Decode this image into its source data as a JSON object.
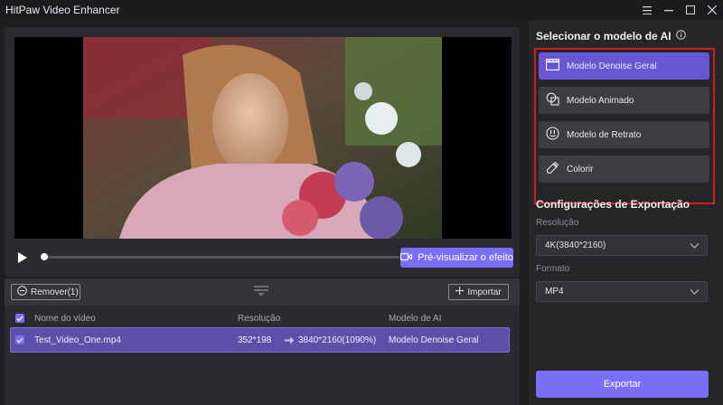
{
  "app": {
    "title": "HitPaw Video Enhancer"
  },
  "player": {
    "preview_label": "Pré-visualizar o efeito",
    "progress": 0
  },
  "list": {
    "remove_label": "Remover(1)",
    "import_label": "Importar",
    "headers": {
      "name": "Nome do vídeo",
      "resolution": "Resolução",
      "model": "Modelo de AI"
    },
    "rows": [
      {
        "name": "Test_Video_One.mp4",
        "res_from": "352*198",
        "res_to": "3840*2160(1090%)",
        "model": "Modelo Denoise Geral"
      }
    ]
  },
  "sidebar": {
    "ai_title": "Selecionar o modelo de AI",
    "models": [
      {
        "label": "Modelo Denoise Geral",
        "icon": "clapperboard-icon",
        "active": true
      },
      {
        "label": "Modelo Animado",
        "icon": "animation-icon",
        "active": false
      },
      {
        "label": "Modelo de Retrato",
        "icon": "portrait-icon",
        "active": false
      },
      {
        "label": "Colorir",
        "icon": "colorize-icon",
        "active": false
      }
    ],
    "export_title": "Configurações de Exportação",
    "resolution_label": "Resolução",
    "resolution_value": "4K(3840*2160)",
    "format_label": "Formato",
    "format_value": "MP4",
    "export_label": "Exportar"
  },
  "colors": {
    "accent": "#7b6ef6",
    "active_model": "#6857d4",
    "highlight_border": "#d0201d"
  }
}
